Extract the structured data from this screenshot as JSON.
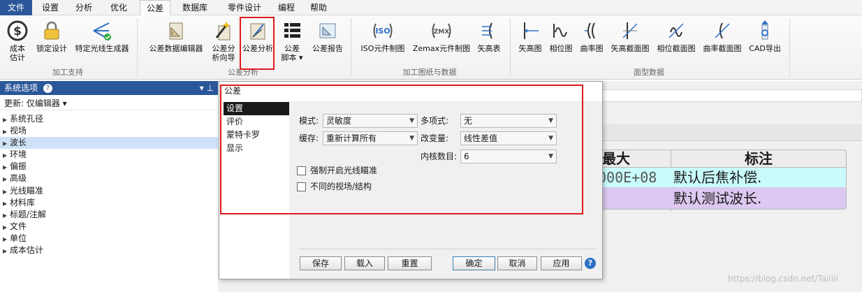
{
  "menu": [
    "文件",
    "设置",
    "分析",
    "优化",
    "公差",
    "数据库",
    "零件设计",
    "编程",
    "帮助"
  ],
  "ribbon": {
    "groups": {
      "machining_support": {
        "label": "加工支持",
        "buttons": [
          {
            "label": "成本\n估计",
            "icon": "dollar-icon"
          },
          {
            "label": "锁定设计",
            "icon": "lock-icon"
          },
          {
            "label": "特定光线生成器",
            "icon": "ray-generator-icon"
          }
        ]
      },
      "tolerance_analysis": {
        "label": "公差分析",
        "buttons": [
          {
            "label": "公差数据编辑器",
            "icon": "tolerance-data-editor-icon"
          },
          {
            "label": "公差分\n析向导",
            "icon": "magic-wand-icon"
          },
          {
            "label": "公差分析",
            "icon": "tolerance-analysis-icon"
          },
          {
            "label": "公差\n脚本 ▾",
            "icon": "script-list-icon"
          },
          {
            "label": "公差报告",
            "icon": "report-icon"
          }
        ]
      },
      "drawings": {
        "label": "加工图纸与数据",
        "buttons": [
          {
            "label": "ISO元件制图",
            "icon": "iso-element-icon"
          },
          {
            "label": "Zemax元件制图",
            "icon": "zmx-element-icon"
          },
          {
            "label": "矢高表",
            "icon": "sag-table-icon"
          }
        ]
      },
      "surface_data": {
        "label": "面型数据",
        "buttons": [
          {
            "label": "矢高图",
            "icon": "sag-plot-icon"
          },
          {
            "label": "相位图",
            "icon": "phase-plot-icon"
          },
          {
            "label": "曲率图",
            "icon": "curvature-plot-icon"
          },
          {
            "label": "矢高截面图",
            "icon": "sag-cross-section-icon"
          },
          {
            "label": "相位截面图",
            "icon": "phase-cross-section-icon"
          },
          {
            "label": "曲率截面图",
            "icon": "curvature-cross-section-icon"
          },
          {
            "label": "CAD导出",
            "icon": "cad-export-icon"
          }
        ]
      }
    }
  },
  "system_options": {
    "header": "系统选项",
    "pin": "▾ ⊥",
    "update_label": "更新: 仅编辑器 ▾",
    "items": [
      "系统孔径",
      "视场",
      "波长",
      "环境",
      "偏振",
      "高级",
      "光线瞄准",
      "材料库",
      "标题/注解",
      "文件",
      "单位",
      "成本估计"
    ],
    "selected": "波长"
  },
  "background_table": {
    "col_max": "最大",
    "col_note": "标注",
    "row1_max": "000E+08",
    "row1_note": "默认后焦补偿.",
    "row2_note": "默认测试波长."
  },
  "dialog": {
    "title": "公差",
    "nav": [
      "设置",
      "评价",
      "蒙特卡罗",
      "显示"
    ],
    "nav_selected": "设置",
    "fields": {
      "mode_label": "模式:",
      "mode_value": "灵敏度",
      "polynomial_label": "多项式:",
      "polynomial_value": "无",
      "cache_label": "缓存:",
      "cache_value": "重新计算所有",
      "variable_label": "改变量:",
      "variable_value": "线性差值",
      "cores_label": "内核数目:",
      "cores_value": "6"
    },
    "checkboxes": {
      "force_ray_aiming": "强制开启光线瞄准",
      "different_fields": "不同的视场/结构"
    },
    "buttons": {
      "save": "保存",
      "load": "载入",
      "reset": "重置",
      "ok": "确定",
      "cancel": "取消",
      "apply": "应用"
    },
    "help": "?"
  },
  "watermark": "https://blog.csdn.net/Taiiiii",
  "colors": {
    "accent": "#2b579a",
    "highlight_red": "#e0191b",
    "row1_bg": "#c9fbfb",
    "row2_bg": "#dcc8f0"
  }
}
